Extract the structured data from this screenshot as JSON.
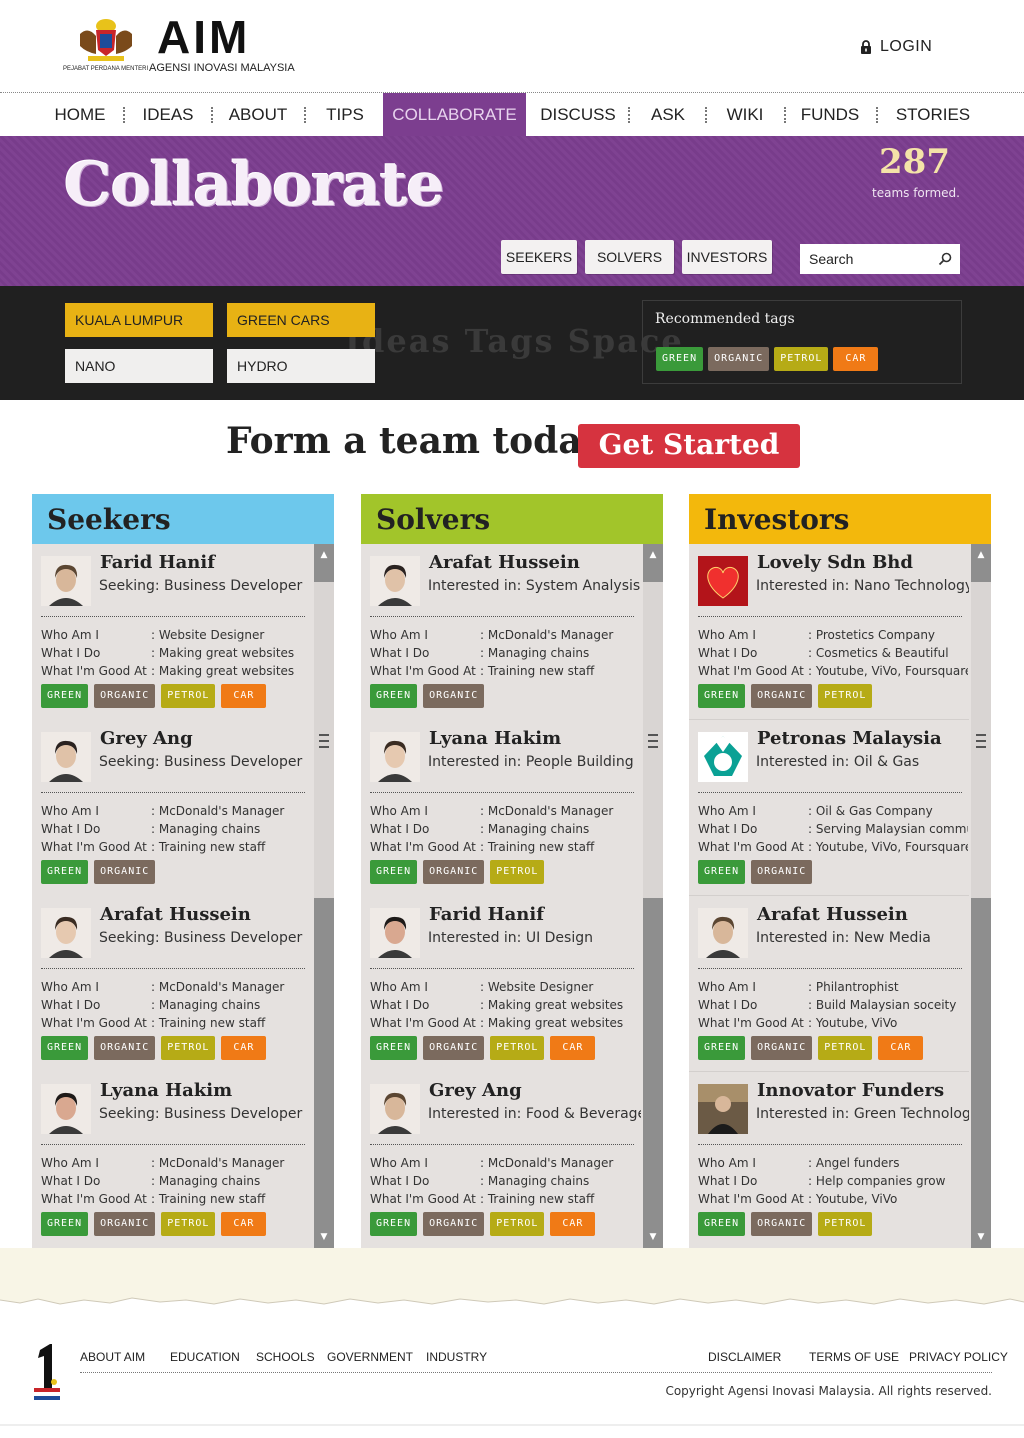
{
  "header": {
    "crest_caption": "PEJABAT PERDANA MENTERI",
    "logo_title": "AIM",
    "logo_subtitle": "AGENSI INOVASI MALAYSIA",
    "login_label": "LOGIN"
  },
  "nav": {
    "items": [
      {
        "label": "HOME"
      },
      {
        "label": "IDEAS"
      },
      {
        "label": "ABOUT"
      },
      {
        "label": "TIPS"
      },
      {
        "label": "COLLABORATE"
      },
      {
        "label": "DISCUSS"
      },
      {
        "label": "ASK"
      },
      {
        "label": "WIKI"
      },
      {
        "label": "FUNDS"
      },
      {
        "label": "STORIES"
      }
    ],
    "active": "COLLABORATE",
    "active_color": "#7c3e8f"
  },
  "banner": {
    "title": "Collaborate",
    "teams_count": "287",
    "teams_label": "teams formed.",
    "filters": [
      "SEEKERS",
      "SOLVERS",
      "INVESTORS"
    ],
    "search_placeholder": "Search"
  },
  "tagspace": {
    "watermark": "Ideas Tags Space",
    "chips": [
      "KUALA LUMPUR",
      "GREEN CARS",
      "NANO",
      "HYDRO"
    ],
    "recommended_title": "Recommended tags",
    "recommended_tags": [
      "GREEN",
      "ORGANIC",
      "PETROL",
      "CAR"
    ]
  },
  "cta": {
    "text": "Form a team today.",
    "button": "Get Started"
  },
  "info_labels": {
    "who": "Who Am I",
    "what": "What I Do",
    "good": "What I'm Good At"
  },
  "columns": [
    {
      "title": "Seekers",
      "color": "#6dc8ec",
      "cards": [
        {
          "name": "Farid Hanif",
          "subtitle": "Seeking: Business Developer",
          "who": ": Website Designer",
          "what": ": Making great websites",
          "good": ": Making great websites",
          "tags": [
            "GREEN",
            "ORGANIC",
            "PETROL",
            "CAR"
          ]
        },
        {
          "name": "Grey Ang",
          "subtitle": "Seeking: Business Developer",
          "who": ": McDonald's Manager",
          "what": ": Managing chains",
          "good": ": Training new staff",
          "tags": [
            "GREEN",
            "ORGANIC"
          ]
        },
        {
          "name": "Arafat Hussein",
          "subtitle": "Seeking: Business Developer",
          "who": ": McDonald's Manager",
          "what": ": Managing chains",
          "good": ": Training new staff",
          "tags": [
            "GREEN",
            "ORGANIC",
            "PETROL",
            "CAR"
          ]
        },
        {
          "name": "Lyana Hakim",
          "subtitle": "Seeking: Business Developer",
          "who": ": McDonald's Manager",
          "what": ": Managing chains",
          "good": ": Training new staff",
          "tags": [
            "GREEN",
            "ORGANIC",
            "PETROL",
            "CAR"
          ]
        }
      ]
    },
    {
      "title": "Solvers",
      "color": "#a2c52a",
      "cards": [
        {
          "name": "Arafat Hussein",
          "subtitle": "Interested in: System Analysis",
          "who": ": McDonald's Manager",
          "what": ": Managing chains",
          "good": ": Training new staff",
          "tags": [
            "GREEN",
            "ORGANIC"
          ]
        },
        {
          "name": "Lyana Hakim",
          "subtitle": "Interested in: People Building",
          "who": ": McDonald's Manager",
          "what": ": Managing chains",
          "good": ": Training new staff",
          "tags": [
            "GREEN",
            "ORGANIC",
            "PETROL"
          ]
        },
        {
          "name": "Farid Hanif",
          "subtitle": "Interested in: UI Design",
          "who": ": Website Designer",
          "what": ": Making great websites",
          "good": ": Making great websites",
          "tags": [
            "GREEN",
            "ORGANIC",
            "PETROL",
            "CAR"
          ]
        },
        {
          "name": "Grey Ang",
          "subtitle": "Interested in: Food & Beverages",
          "who": ": McDonald's Manager",
          "what": ": Managing chains",
          "good": ": Training new staff",
          "tags": [
            "GREEN",
            "ORGANIC",
            "PETROL",
            "CAR"
          ]
        }
      ]
    },
    {
      "title": "Investors",
      "color": "#f3b80c",
      "cards": [
        {
          "name": "Lovely Sdn Bhd",
          "subtitle": "Interested in: Nano Technology",
          "who": ": Prostetics Company",
          "what": ": Cosmetics & Beautiful",
          "good": ": Youtube, ViVo, Foursquare",
          "tags": [
            "GREEN",
            "ORGANIC",
            "PETROL"
          ]
        },
        {
          "name": "Petronas Malaysia",
          "subtitle": "Interested in: Oil & Gas",
          "who": ": Oil & Gas Company",
          "what": ": Serving Malaysian communities",
          "good": ": Youtube, ViVo, Foursquare",
          "tags": [
            "GREEN",
            "ORGANIC"
          ]
        },
        {
          "name": "Arafat Hussein",
          "subtitle": "Interested in: New Media",
          "who": ": Philantrophist",
          "what": ": Build Malaysian soceity",
          "good": ": Youtube, ViVo",
          "tags": [
            "GREEN",
            "ORGANIC",
            "PETROL",
            "CAR"
          ]
        },
        {
          "name": "Innovator Funders",
          "subtitle": "Interested in: Green Technology",
          "who": ": Angel funders",
          "what": ": Help companies grow",
          "good": ": Youtube, ViVo",
          "tags": [
            "GREEN",
            "ORGANIC",
            "PETROL"
          ]
        }
      ]
    }
  ],
  "footer": {
    "left_links": [
      "ABOUT AIM",
      "EDUCATION",
      "SCHOOLS",
      "GOVERNMENT",
      "INDUSTRY"
    ],
    "right_links": [
      "DISCLAIMER",
      "TERMS OF USE",
      "PRIVACY POLICY"
    ],
    "copyright": "Copyright Agensi Inovasi Malaysia. All rights reserved."
  }
}
